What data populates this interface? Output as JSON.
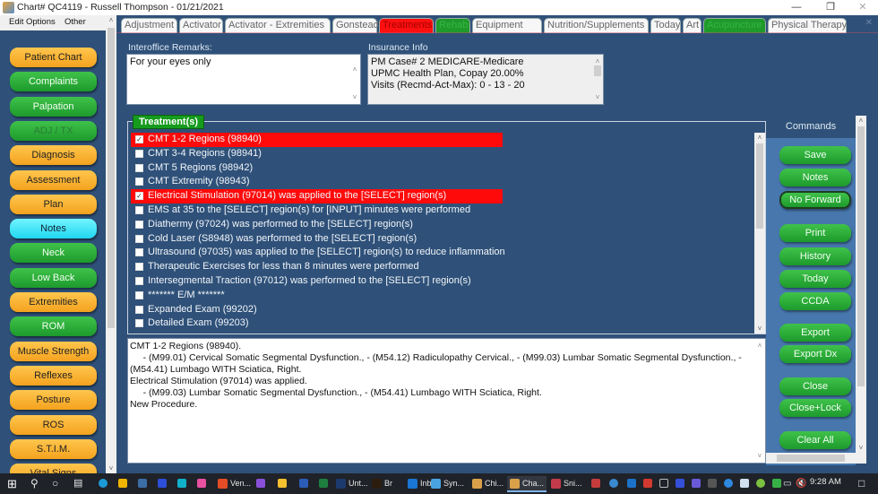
{
  "window": {
    "title": "Chart# QC4119 - Russell Thompson - 01/21/2021",
    "minimize_glyph": "—",
    "restore_glyph": "❐",
    "close_glyph": "✕"
  },
  "menu": {
    "edit_options": "Edit Options",
    "other": "Other"
  },
  "sidebar": {
    "items": [
      {
        "label": "Patient Chart",
        "color": "orange"
      },
      {
        "label": "Complaints",
        "color": "green"
      },
      {
        "label": "Palpation",
        "color": "green"
      },
      {
        "label": "ADJ / TX",
        "color": "green",
        "disabled": true
      },
      {
        "label": "Diagnosis",
        "color": "orange"
      },
      {
        "label": "Assessment",
        "color": "orange"
      },
      {
        "label": "Plan",
        "color": "orange"
      },
      {
        "label": "Notes",
        "color": "cyan"
      },
      {
        "label": "Neck",
        "color": "green"
      },
      {
        "label": "Low Back",
        "color": "green"
      },
      {
        "label": "Extremities",
        "color": "orange"
      },
      {
        "label": "ROM",
        "color": "green"
      },
      {
        "label": "Muscle Strength",
        "color": "orange"
      },
      {
        "label": "Reflexes",
        "color": "orange"
      },
      {
        "label": "Posture",
        "color": "orange"
      },
      {
        "label": "ROS",
        "color": "orange"
      },
      {
        "label": "S.T.I.M.",
        "color": "orange"
      },
      {
        "label": "Vital Signs",
        "color": "orange"
      }
    ]
  },
  "tabs": [
    {
      "label": "Adjustment",
      "style": "normal"
    },
    {
      "label": "Activator",
      "style": "normal"
    },
    {
      "label": "Activator - Extremities",
      "style": "normal"
    },
    {
      "label": "Gonstead",
      "style": "normal"
    },
    {
      "label": "Treatments",
      "style": "red",
      "active": true
    },
    {
      "label": "Rehab",
      "style": "green"
    },
    {
      "label": "Equipment",
      "style": "normal"
    },
    {
      "label": "Nutrition/Supplements",
      "style": "normal"
    },
    {
      "label": "Today",
      "style": "normal"
    },
    {
      "label": "Art",
      "style": "normal"
    },
    {
      "label": "Acupuncture",
      "style": "green"
    },
    {
      "label": "Physical Therapy",
      "style": "normal"
    }
  ],
  "remarks": {
    "label": "Interoffice Remarks:",
    "value": "For your eyes only"
  },
  "insurance": {
    "label": "Insurance Info",
    "lines": [
      "PM Case# 2  MEDICARE-Medicare",
      "UPMC Health Plan, Copay 20.00%",
      "Visits (Recmd-Act-Max):  0 - 13 - 20"
    ]
  },
  "treatments": {
    "title": "Treatment(s)",
    "items": [
      {
        "label": "CMT 1-2 Regions (98940)",
        "checked": true
      },
      {
        "label": "CMT 3-4 Regions (98941)",
        "checked": false
      },
      {
        "label": "CMT 5 Regions (98942)",
        "checked": false
      },
      {
        "label": "CMT Extremity (98943)",
        "checked": false
      },
      {
        "label": "Electrical Stimulation (97014) was applied to the [SELECT] region(s)",
        "checked": true
      },
      {
        "label": "EMS at 35  to the  [SELECT] region(s) for [INPUT] minutes were performed",
        "checked": false
      },
      {
        "label": "Diathermy (97024) was performed to the [SELECT] region(s)",
        "checked": false
      },
      {
        "label": "Cold Laser (S8948) was performed to the [SELECT] region(s)",
        "checked": false
      },
      {
        "label": "Ultrasound (97035) was applied to the [SELECT] region(s) to reduce inflammation",
        "checked": false
      },
      {
        "label": "Therapeutic Exercises for less than 8 minutes were performed",
        "checked": false
      },
      {
        "label": "Intersegmental Traction (97012) was performed to the [SELECT] region(s)",
        "checked": false
      },
      {
        "label": "******* E/M *******",
        "checked": false
      },
      {
        "label": "Expanded Exam (99202)",
        "checked": false
      },
      {
        "label": "Detailed Exam (99203)",
        "checked": false
      }
    ]
  },
  "notes_text": {
    "lines": [
      "CMT 1-2 Regions (98940).",
      "     - (M99.01) Cervical Somatic Segmental Dysfunction., - (M54.12) Radiculopathy Cervical., - (M99.03) Lumbar Somatic Segmental Dysfunction., - (M54.41) Lumbago WITH Sciatica, Right.",
      "Electrical Stimulation (97014) was applied.",
      "     - (M99.03) Lumbar Somatic Segmental Dysfunction., - (M54.41) Lumbago WITH Sciatica, Right.",
      "New Procedure."
    ]
  },
  "commands": {
    "title": "Commands",
    "buttons": [
      {
        "label": "Save"
      },
      {
        "label": "Notes"
      },
      {
        "label": "No Forward",
        "outlined": true
      },
      {
        "label": "Print"
      },
      {
        "label": "History"
      },
      {
        "label": "Today"
      },
      {
        "label": "CCDA"
      },
      {
        "label": "Export"
      },
      {
        "label": "Export Dx"
      },
      {
        "label": "Close"
      },
      {
        "label": "Close+Lock"
      },
      {
        "label": "Clear All"
      }
    ]
  },
  "taskbar": {
    "apps": [
      {
        "label": "Ven...",
        "color": "#e34c26"
      },
      {
        "label": "Unt...",
        "color": "#1c3a6e"
      },
      {
        "label": "Br",
        "color": "#2b1d0e"
      },
      {
        "label": "Inb...",
        "color": "#1976d2"
      },
      {
        "label": "Syn...",
        "color": "#4aa3df"
      },
      {
        "label": "Chi...",
        "color": "#d9a04a"
      },
      {
        "label": "Cha...",
        "color": "#d9a04a",
        "active": true
      },
      {
        "label": "Sni...",
        "color": "#c33b4b"
      }
    ],
    "clock": "9:28 AM"
  }
}
